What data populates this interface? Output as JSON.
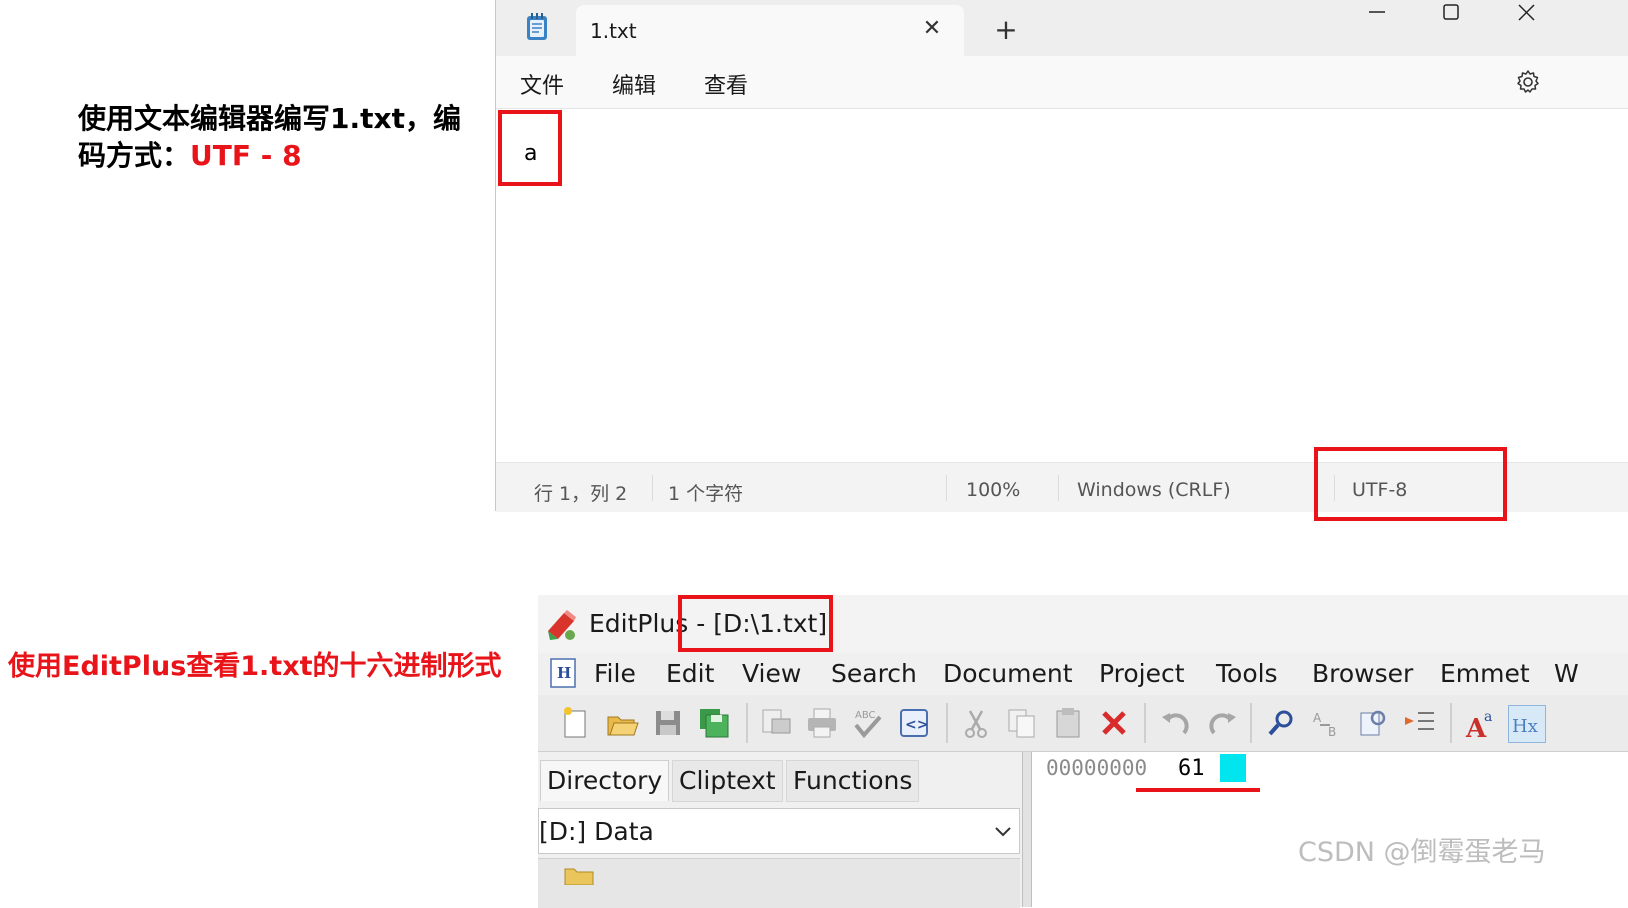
{
  "annotations": {
    "caption_top_text": "使用文本编辑器编写1.txt，编码方式：",
    "caption_top_encoding": "UTF - 8",
    "caption_bottom": "使用EditPlus查看1.txt的十六进制形式",
    "highlight_color": "#e8141a"
  },
  "notepad": {
    "app_icon": "notepad-icon",
    "tab_title": "1.txt",
    "new_tab_label": "+",
    "window_controls": {
      "minimize": "minimize-icon",
      "maximize": "maximize-icon",
      "close": "close-icon"
    },
    "menu": {
      "file": "文件",
      "edit": "编辑",
      "view": "查看"
    },
    "settings_icon": "gear-icon",
    "content": "a",
    "status": {
      "position": "行 1，列 2",
      "char_count": "1 个字符",
      "zoom": "100%",
      "line_ending": "Windows (CRLF)",
      "encoding": "UTF-8"
    }
  },
  "editplus": {
    "app_name": "EditPlus",
    "title_separator": "-",
    "file_path": "[D:\\1.txt]",
    "menu": [
      "File",
      "Edit",
      "View",
      "Search",
      "Document",
      "Project",
      "Tools",
      "Browser",
      "Emmet",
      "W"
    ],
    "toolbar_icons": [
      "new-file-icon",
      "open-folder-icon",
      "save-icon",
      "save-all-icon",
      "print-preview-icon",
      "print-icon",
      "spellcheck-icon",
      "browser-preview-icon",
      "cut-icon",
      "copy-icon",
      "paste-icon",
      "delete-icon",
      "undo-icon",
      "redo-icon",
      "find-icon",
      "replace-icon",
      "find-in-files-icon",
      "indent-icon",
      "font-icon",
      "hex-view-icon"
    ],
    "sidebar_tabs": {
      "directory": "Directory",
      "cliptext": "Cliptext",
      "functions": "Functions"
    },
    "drive": "[D:] Data",
    "hex": {
      "address": "00000000",
      "byte": "61",
      "ascii_cursor_color": "#00e5ee"
    }
  },
  "watermark": "CSDN @倒霉蛋老马"
}
